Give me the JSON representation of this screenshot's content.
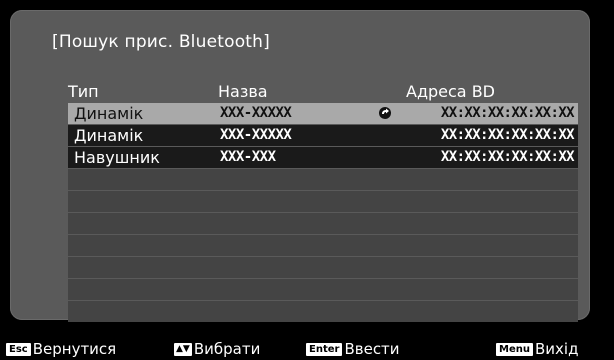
{
  "panel": {
    "title": "[Пошук прис. Bluetooth]"
  },
  "table": {
    "headers": {
      "type": "Тип",
      "name": "Назва",
      "address": "Адреса BD"
    },
    "rows": [
      {
        "type": "Динамік",
        "name": "XXX-XXXXX",
        "address": "XX:XX:XX:XX:XX:XX",
        "selected": true,
        "connected": true
      },
      {
        "type": "Динамік",
        "name": "XXX-XXXXX",
        "address": "XX:XX:XX:XX:XX:XX",
        "selected": false,
        "connected": false
      },
      {
        "type": "Навушник",
        "name": "XXX-XXX",
        "address": "XX:XX:XX:XX:XX:XX",
        "selected": false,
        "connected": false
      }
    ],
    "empty_row_count": 7
  },
  "footer": {
    "back": {
      "key": "Esc",
      "label": "Вернутися"
    },
    "select": {
      "key": "▲▼",
      "label": "Вибрати"
    },
    "enter": {
      "key": "Enter",
      "label": "Ввести"
    },
    "exit": {
      "key": "Menu",
      "label": "Вихід"
    }
  },
  "colors": {
    "panel": "#5a5a5a",
    "row_filled": "#1a1a1a",
    "row_empty": "#444444",
    "row_selected": "#a9a9a9"
  },
  "icons": {
    "connected": "connected-link-icon"
  }
}
